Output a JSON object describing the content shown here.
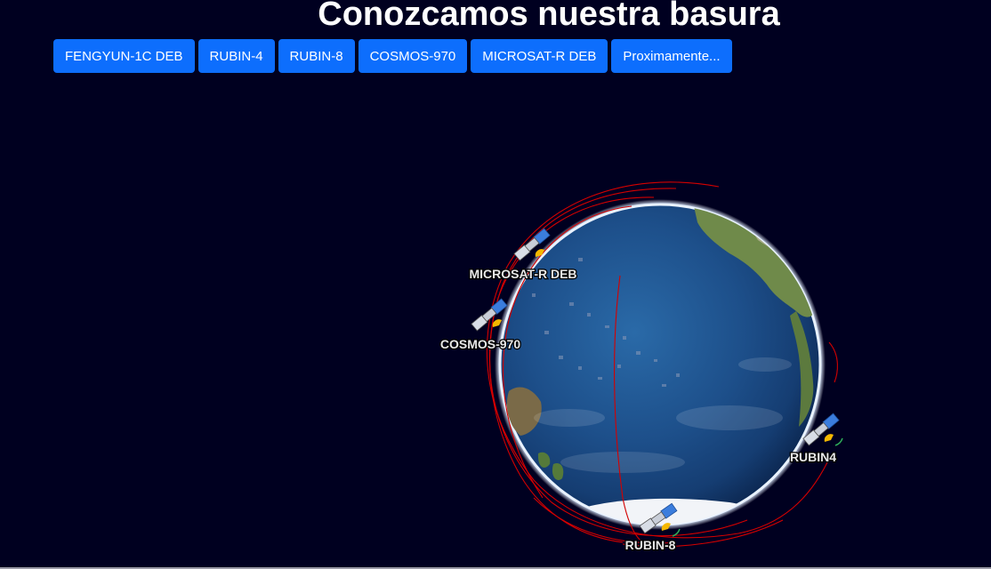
{
  "page": {
    "title": "Conozcamos nuestra basura"
  },
  "toolbar": {
    "buttons": [
      {
        "label": "FENGYUN-1C DEB"
      },
      {
        "label": "RUBIN-4"
      },
      {
        "label": "RUBIN-8"
      },
      {
        "label": "COSMOS-970"
      },
      {
        "label": "MICROSAT-R DEB"
      },
      {
        "label": "Proximamente..."
      }
    ]
  },
  "globe": {
    "satellites": [
      {
        "label": "MICROSAT-R DEB",
        "icon": "satellite-icon"
      },
      {
        "label": "COSMOS-970",
        "icon": "satellite-icon"
      },
      {
        "label": "RUBIN4",
        "icon": "satellite-icon"
      },
      {
        "label": "RUBIN-8",
        "icon": "satellite-icon"
      }
    ]
  },
  "colors": {
    "background": "#000020",
    "button": "#0d6efd",
    "orbit": "#d40000",
    "ocean": "#1d4f8a"
  }
}
